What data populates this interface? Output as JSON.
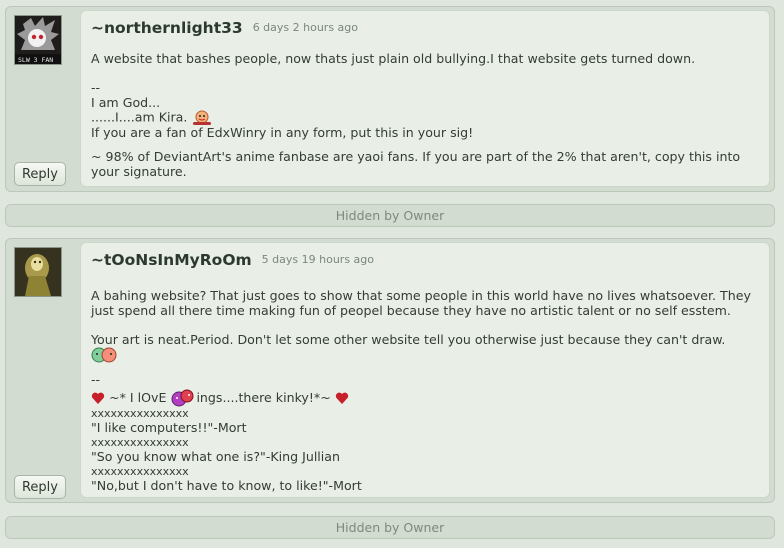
{
  "reply_label": "Reply",
  "hidden_label": "Hidden by Owner",
  "comment1": {
    "username": "~northernlight33",
    "timestamp": "6 days 2 hours ago",
    "avatar_badge": "SLW 3 FAN",
    "line1": "A website that bashes people, now thats just plain old bullying.I that website gets turned down.",
    "sig_sep": "--",
    "sig1": "I am God...",
    "sig2": "......I....am Kira.",
    "sig3": "If you are a fan of EdxWinry in any form, put this in your sig!",
    "sig4": "~ 98% of DeviantArt's anime fanbase are yaoi fans. If you are part of the 2% that aren't, copy this into",
    "sig5": "your signature."
  },
  "comment2": {
    "username": "~tOoNsInMyRoOm",
    "timestamp": "5 days 19 hours ago",
    "line1": "A bahing website? That just goes to show that some people in this world have no lives whatsoever. They",
    "line2": "just spend all there time making fun of peopel because they have no artistic talent or no self esstem.",
    "line3": "Your art is neat.Period. Don't let some other website tell you otherwise just because they can't draw.",
    "sig_sep": "--",
    "sig_love_a": "~* I lOvE",
    "sig_love_b": "ings....there kinky!*~",
    "x1": "xxxxxxxxxxxxxxx",
    "q1": "\"I like computers!!\"-Mort",
    "x2": "xxxxxxxxxxxxxxx",
    "q2": "\"So you know what one is?\"-King Jullian",
    "x3": "xxxxxxxxxxxxxxx",
    "q3": "\"No,but I don't have to know, to like!\"-Mort"
  },
  "colors": {
    "page_bg": "#dfe6dd",
    "panel_bg": "#d3dcd0",
    "body_bg": "#e9eee7",
    "heart": "#c8202a"
  }
}
